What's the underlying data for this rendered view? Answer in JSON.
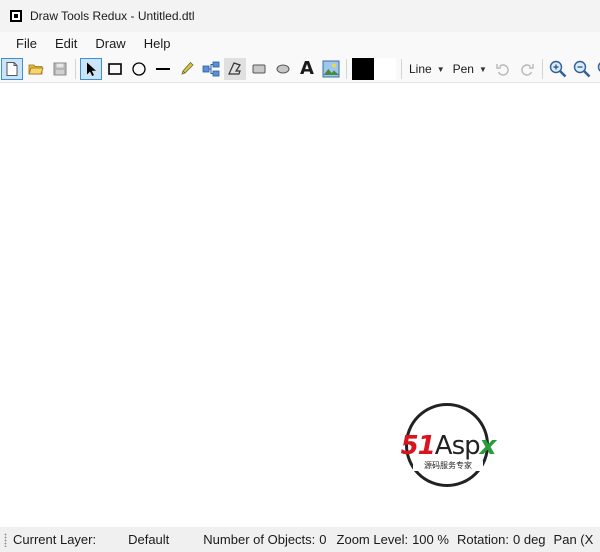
{
  "window": {
    "title": "Draw Tools Redux - Untitled.dtl"
  },
  "menu": {
    "items": [
      "File",
      "Edit",
      "Draw",
      "Help"
    ]
  },
  "toolbar": {
    "line_dropdown": "Line",
    "pen_dropdown": "Pen",
    "text_tool_glyph": "A",
    "fill_color": "#000000",
    "background_color": "#ffffff"
  },
  "watermark": {
    "brand_red": "51",
    "brand_black": "Asp",
    "brand_green": "x",
    "subtitle": "源码服务专家"
  },
  "status": {
    "current_layer_label": "Current Layer:",
    "current_layer_value": "Default",
    "objects_label": "Number of Objects:",
    "objects_value": "0",
    "zoom_label": "Zoom Level:",
    "zoom_value": "100 %",
    "rotation_label": "Rotation:",
    "rotation_value": "0 deg",
    "pan_label": "Pan (X"
  }
}
